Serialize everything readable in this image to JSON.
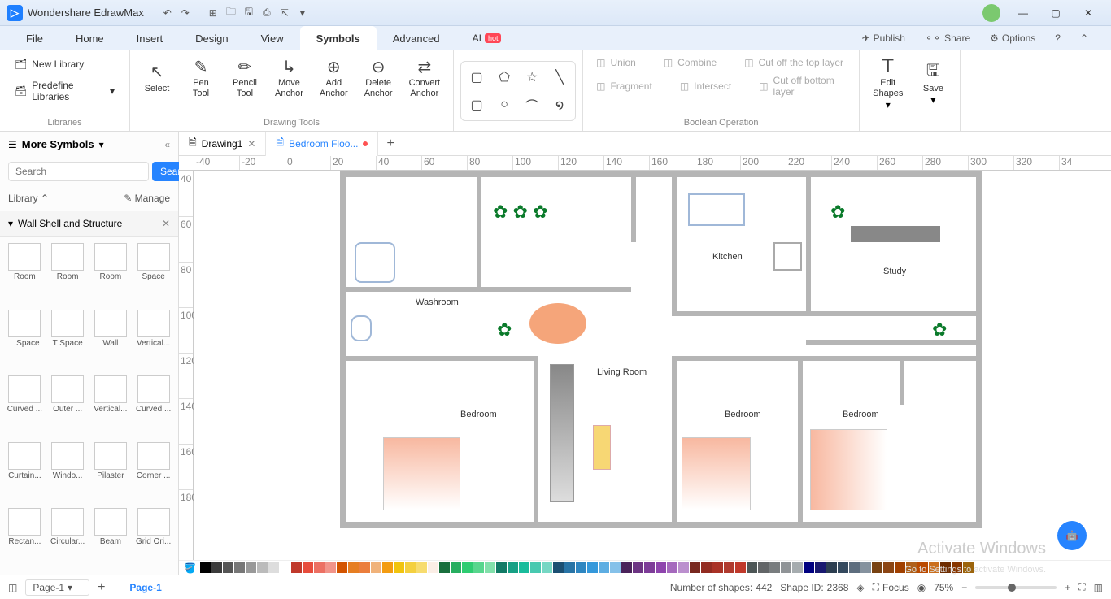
{
  "app": {
    "title": "Wondershare EdrawMax"
  },
  "menu": {
    "items": [
      "File",
      "Home",
      "Insert",
      "Design",
      "View",
      "Symbols",
      "Advanced",
      "AI"
    ],
    "active": "Symbols",
    "publish": "Publish",
    "share": "Share",
    "options": "Options"
  },
  "toolbar": {
    "new_library": "New Library",
    "predefine_libraries": "Predefine Libraries",
    "libraries_label": "Libraries",
    "select": "Select",
    "pen_tool": "Pen\nTool",
    "pencil_tool": "Pencil\nTool",
    "move_anchor": "Move\nAnchor",
    "add_anchor": "Add\nAnchor",
    "delete_anchor": "Delete\nAnchor",
    "convert_anchor": "Convert\nAnchor",
    "drawing_tools": "Drawing Tools",
    "union": "Union",
    "combine": "Combine",
    "cut_top": "Cut off the top layer",
    "fragment": "Fragment",
    "intersect": "Intersect",
    "cut_bottom": "Cut off bottom layer",
    "boolean_operation": "Boolean Operation",
    "edit_shapes": "Edit\nShapes",
    "save": "Save"
  },
  "sidebar": {
    "title": "More Symbols",
    "search_placeholder": "Search",
    "search_btn": "Search",
    "library": "Library",
    "manage": "Manage",
    "category": "Wall Shell and Structure",
    "shapes": [
      "Room",
      "Room",
      "Room",
      "Space",
      "L Space",
      "T Space",
      "Wall",
      "Vertical...",
      "Curved ...",
      "Outer ...",
      "Vertical...",
      "Curved ...",
      "Curtain...",
      "Windo...",
      "Pilaster",
      "Corner ...",
      "Rectan...",
      "Circular...",
      "Beam",
      "Grid Ori..."
    ]
  },
  "tabs": {
    "doc1": "Drawing1",
    "doc2": "Bedroom Floo..."
  },
  "ruler_h": [
    "-40",
    "-20",
    "0",
    "20",
    "40",
    "60",
    "80",
    "100",
    "120",
    "140",
    "160",
    "180",
    "200",
    "220",
    "240",
    "260",
    "280",
    "300",
    "320",
    "34"
  ],
  "ruler_v": [
    "40",
    "60",
    "80",
    "100",
    "120",
    "140",
    "160",
    "180"
  ],
  "floorplan": {
    "washroom": "Washroom",
    "kitchen": "Kitchen",
    "study": "Study",
    "living_room": "Living Room",
    "bedroom1": "Bedroom",
    "bedroom2": "Bedroom",
    "bedroom3": "Bedroom"
  },
  "status": {
    "page_selector": "Page-1",
    "page_tab": "Page-1",
    "num_shapes_label": "Number of shapes:",
    "num_shapes": "442",
    "shape_id_label": "Shape ID:",
    "shape_id": "2368",
    "focus": "Focus",
    "zoom": "75%"
  },
  "watermark": {
    "line1": "Activate Windows",
    "line2": "Go to Settings to activate Windows."
  },
  "colors": [
    "#000",
    "#3b3b3b",
    "#555",
    "#777",
    "#999",
    "#bbb",
    "#ddd",
    "#fff",
    "#c0392b",
    "#e74c3c",
    "#ec7063",
    "#f1948a",
    "#d35400",
    "#e67e22",
    "#eb7e3c",
    "#f0b27a",
    "#f39c12",
    "#f1c40f",
    "#f4d03f",
    "#f7dc6f",
    "#fbeee6",
    "#196f3d",
    "#27ae60",
    "#2ecc71",
    "#58d68d",
    "#82e0aa",
    "#117a65",
    "#16a085",
    "#1abc9c",
    "#48c9b0",
    "#76d7c4",
    "#1b4f72",
    "#2874a6",
    "#2e86c1",
    "#3498db",
    "#5dade2",
    "#85c1e9",
    "#4a235a",
    "#6c3483",
    "#7d3c98",
    "#8e44ad",
    "#a569bd",
    "#bb8fce",
    "#78281f",
    "#922b21",
    "#a93226",
    "#b03a2e",
    "#c0392b",
    "#4d5656",
    "#626567",
    "#797d7f",
    "#909497",
    "#a6acaf",
    "#000080",
    "#191970",
    "#2c3e50",
    "#34495e",
    "#5d6d7e",
    "#85929e",
    "#784212",
    "#8b4513",
    "#a04000",
    "#af601a",
    "#ba4a00",
    "#ca6f1e",
    "#6e2c00",
    "#873600",
    "#9c640c"
  ]
}
